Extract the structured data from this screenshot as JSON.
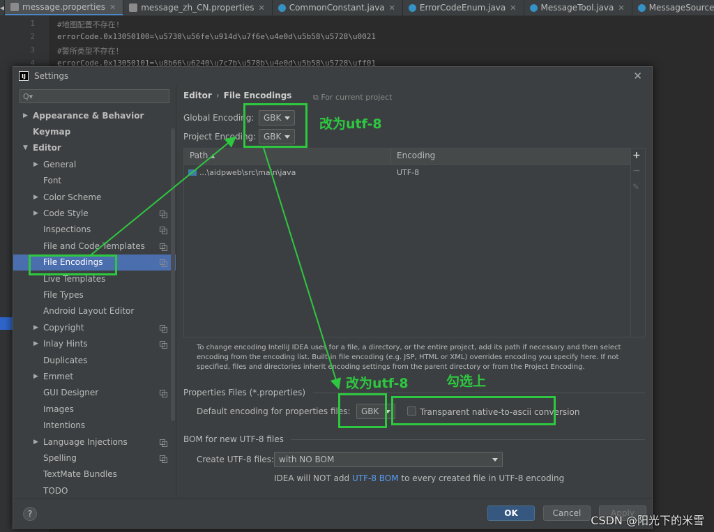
{
  "tabs": [
    {
      "label": "message.properties",
      "kind": "props",
      "active": true
    },
    {
      "label": "message_zh_CN.properties",
      "kind": "props",
      "active": false
    },
    {
      "label": "CommonConstant.java",
      "kind": "java",
      "active": false
    },
    {
      "label": "ErrorCodeEnum.java",
      "kind": "java",
      "active": false
    },
    {
      "label": "MessageTool.java",
      "kind": "java",
      "active": false
    },
    {
      "label": "MessageSourceConfiguratio",
      "kind": "java",
      "active": false
    }
  ],
  "editor": {
    "lines": [
      {
        "num": "1",
        "text": "#地图配置不存在!",
        "comment": true
      },
      {
        "num": "2",
        "text": "errorCode.0x13050100=\\u5730\\u56fe\\u914d\\u7f6e\\u4e0d\\u5b58\\u5728\\u0021",
        "comment": false
      },
      {
        "num": "3",
        "text": "#警所类型不存在！",
        "comment": true
      },
      {
        "num": "4",
        "text": "errorCode.0x13050101=\\u8b66\\u6240\\u7c7b\\u578b\\u4e0d\\u5b58\\u5728\\uff01",
        "comment": false
      }
    ]
  },
  "dialog": {
    "title": "Settings",
    "app_icon_text": "IJ",
    "search_placeholder": "Q▾",
    "tree": [
      {
        "label": "Appearance & Behavior",
        "level": 0,
        "arrow": "▶",
        "bold": true,
        "copy": false
      },
      {
        "label": "Keymap",
        "level": 0,
        "arrow": "",
        "bold": true,
        "copy": false
      },
      {
        "label": "Editor",
        "level": 0,
        "arrow": "▼",
        "bold": true,
        "copy": false
      },
      {
        "label": "General",
        "level": 1,
        "arrow": "▶",
        "bold": false,
        "copy": false
      },
      {
        "label": "Font",
        "level": 1,
        "arrow": "",
        "bold": false,
        "copy": false
      },
      {
        "label": "Color Scheme",
        "level": 1,
        "arrow": "▶",
        "bold": false,
        "copy": false
      },
      {
        "label": "Code Style",
        "level": 1,
        "arrow": "▶",
        "bold": false,
        "copy": true
      },
      {
        "label": "Inspections",
        "level": 1,
        "arrow": "",
        "bold": false,
        "copy": true
      },
      {
        "label": "File and Code Templates",
        "level": 1,
        "arrow": "",
        "bold": false,
        "copy": true
      },
      {
        "label": "File Encodings",
        "level": 1,
        "arrow": "",
        "bold": false,
        "copy": true,
        "selected": true
      },
      {
        "label": "Live Templates",
        "level": 1,
        "arrow": "",
        "bold": false,
        "copy": false
      },
      {
        "label": "File Types",
        "level": 1,
        "arrow": "",
        "bold": false,
        "copy": false
      },
      {
        "label": "Android Layout Editor",
        "level": 1,
        "arrow": "",
        "bold": false,
        "copy": false
      },
      {
        "label": "Copyright",
        "level": 1,
        "arrow": "▶",
        "bold": false,
        "copy": true
      },
      {
        "label": "Inlay Hints",
        "level": 1,
        "arrow": "▶",
        "bold": false,
        "copy": true
      },
      {
        "label": "Duplicates",
        "level": 1,
        "arrow": "",
        "bold": false,
        "copy": false
      },
      {
        "label": "Emmet",
        "level": 1,
        "arrow": "▶",
        "bold": false,
        "copy": false
      },
      {
        "label": "GUI Designer",
        "level": 1,
        "arrow": "",
        "bold": false,
        "copy": true
      },
      {
        "label": "Images",
        "level": 1,
        "arrow": "",
        "bold": false,
        "copy": false
      },
      {
        "label": "Intentions",
        "level": 1,
        "arrow": "",
        "bold": false,
        "copy": false
      },
      {
        "label": "Language Injections",
        "level": 1,
        "arrow": "▶",
        "bold": false,
        "copy": true
      },
      {
        "label": "Spelling",
        "level": 1,
        "arrow": "",
        "bold": false,
        "copy": true
      },
      {
        "label": "TextMate Bundles",
        "level": 1,
        "arrow": "",
        "bold": false,
        "copy": false
      },
      {
        "label": "TODO",
        "level": 1,
        "arrow": "",
        "bold": false,
        "copy": false
      }
    ],
    "breadcrumb": {
      "parent": "Editor",
      "separator": "›",
      "current": "File Encodings"
    },
    "project_hint": "⧉ For current project",
    "global_encoding": {
      "label": "Global Encoding:",
      "value": "GBK"
    },
    "project_encoding": {
      "label": "Project Encoding:",
      "value": "GBK"
    },
    "table": {
      "headers": {
        "path": "Path ▴",
        "encoding": "Encoding"
      },
      "rows": [
        {
          "path": "...\\aidpweb\\src\\main\\java",
          "encoding": "UTF-8"
        }
      ],
      "tools": {
        "add": "+",
        "remove": "−",
        "edit": "✎"
      }
    },
    "description": "To change encoding IntelliJ IDEA uses for a file, a directory, or the entire project, add its path if necessary and then select encoding from the encoding list. Built-in file encoding (e.g. JSP, HTML or XML) overrides encoding you specify here. If not specified, files and directories inherit encoding settings from the parent directory or from the Project Encoding.",
    "properties_section": "Properties Files (*.properties)",
    "properties_default": {
      "label": "Default encoding for properties files:",
      "value": "GBK"
    },
    "transparent_label": "Transparent native-to-ascii conversion",
    "transparent_checked": false,
    "bom_section": "BOM for new UTF-8 files",
    "create_utf8": {
      "label": "Create UTF-8 files:",
      "value": "with NO BOM"
    },
    "bom_note": {
      "before": "IDEA will NOT add ",
      "link": "UTF-8 BOM",
      "after": " to every created file in UTF-8 encoding"
    },
    "buttons": {
      "help": "?",
      "ok": "OK",
      "cancel": "Cancel",
      "apply": "Apply"
    }
  },
  "annotations": {
    "note_top": "改为utf-8",
    "note_properties": "改为utf-8",
    "note_check": "勾选上",
    "color": "#2ec840"
  },
  "watermark": "CSDN @阳光下的米雪"
}
